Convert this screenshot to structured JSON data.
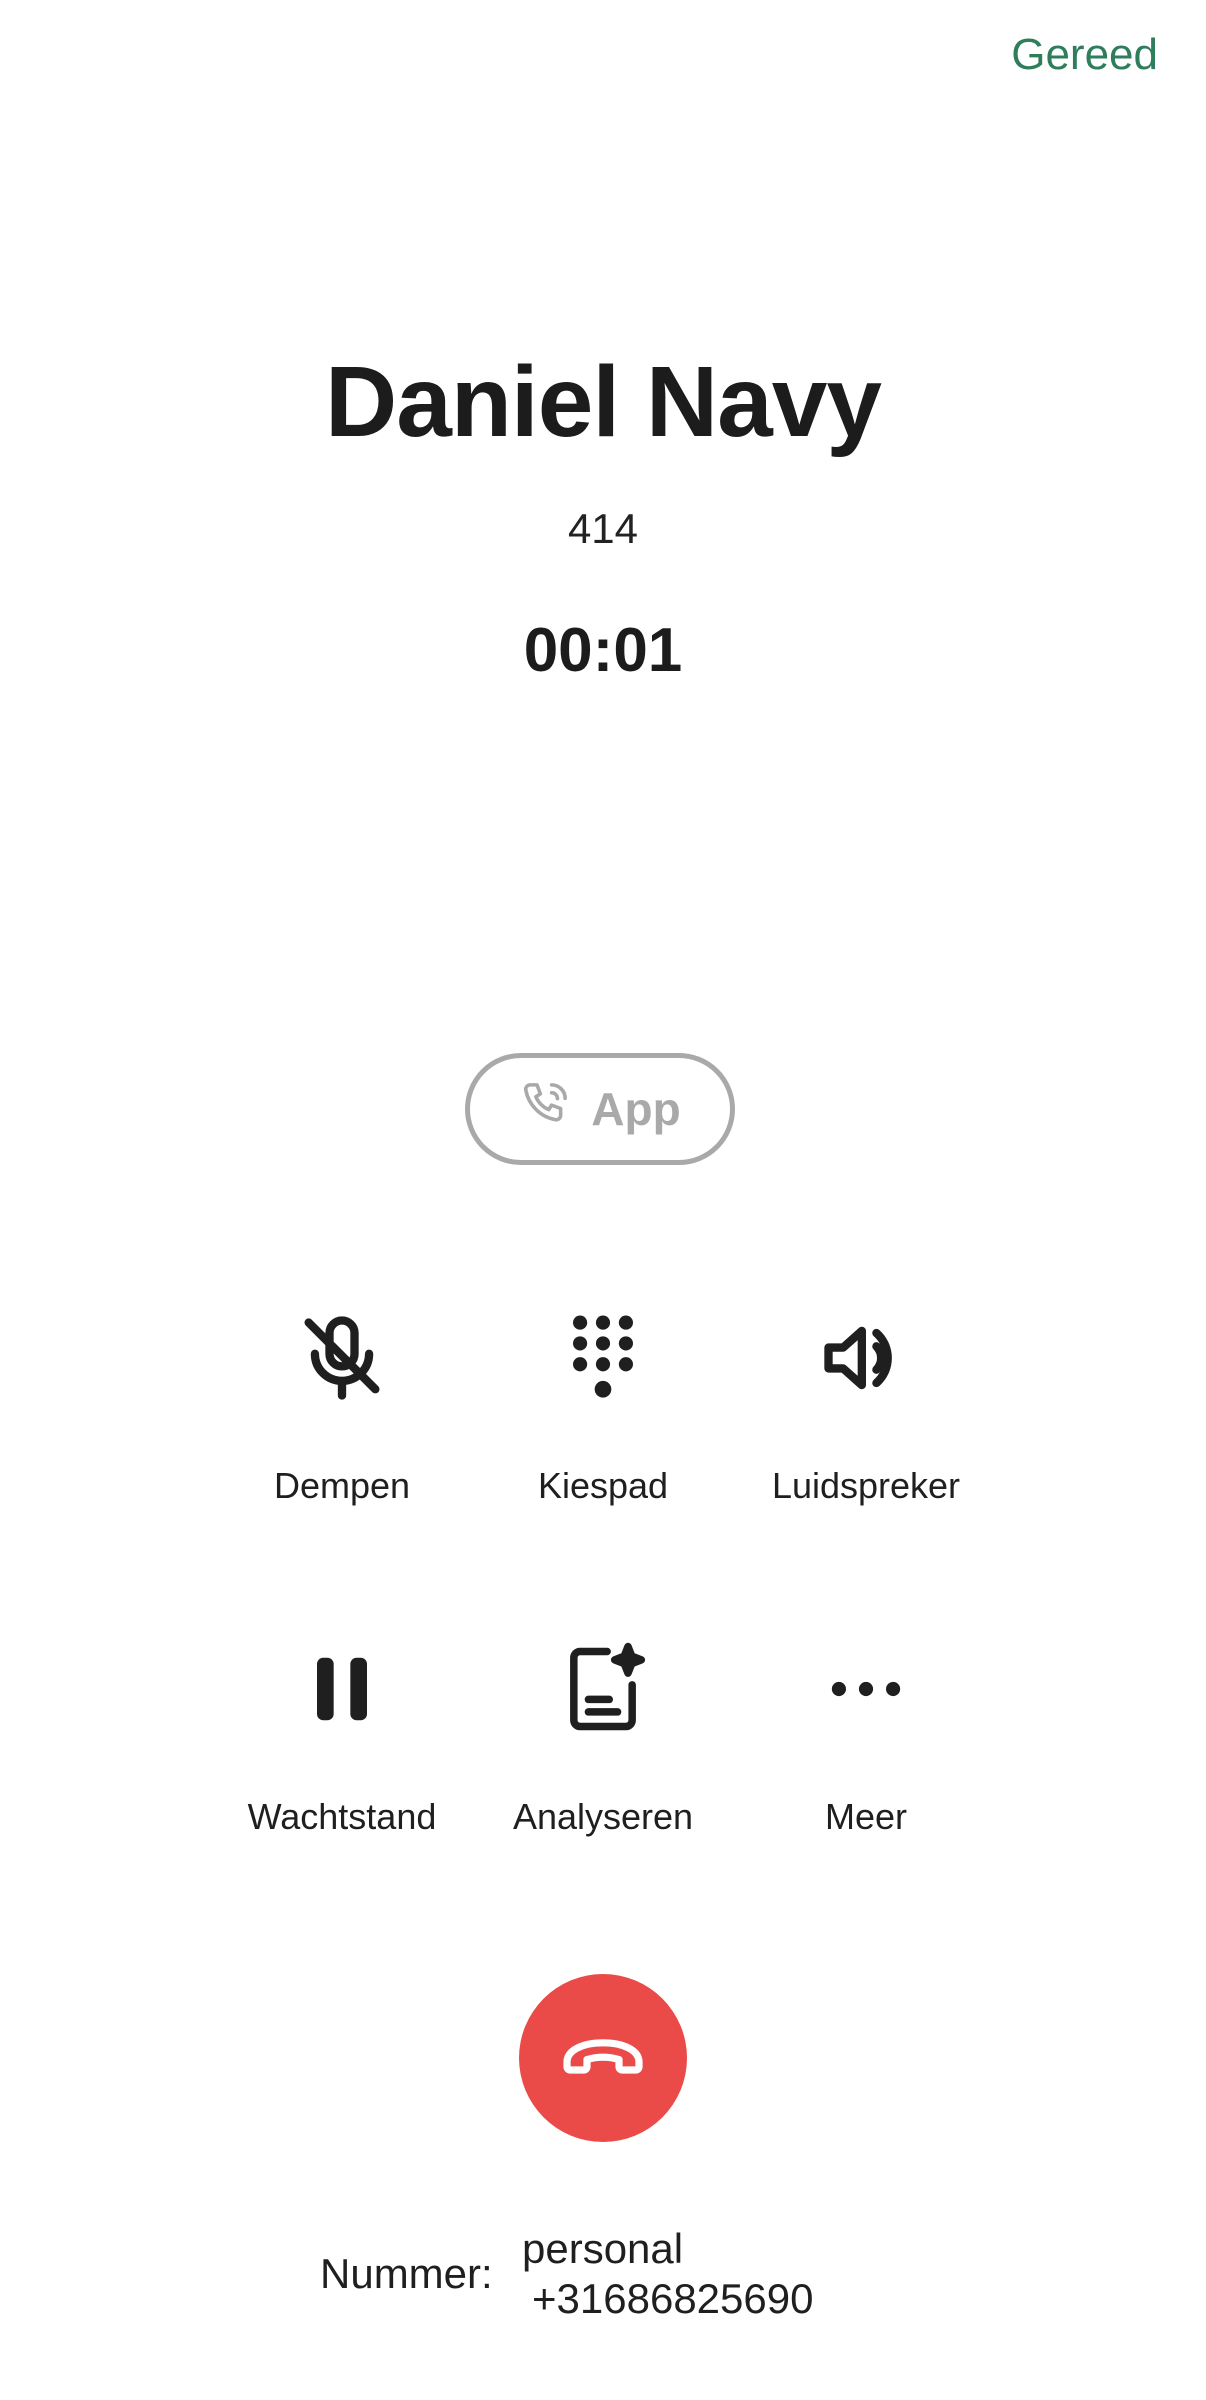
{
  "header": {
    "done_label": "Gereed"
  },
  "caller": {
    "name": "Daniel Navy",
    "extension": "414",
    "timer": "00:01"
  },
  "app_switch": {
    "label": "App",
    "icon": "phone-call-icon"
  },
  "controls": [
    {
      "label": "Dempen",
      "icon": "mic-off-icon"
    },
    {
      "label": "Kiespad",
      "icon": "keypad-icon"
    },
    {
      "label": "Luidspreker",
      "icon": "speaker-icon"
    },
    {
      "label": "Wachtstand",
      "icon": "pause-icon"
    },
    {
      "label": "Analyseren",
      "icon": "analyze-document-icon"
    },
    {
      "label": "Meer",
      "icon": "more-icon"
    }
  ],
  "end_call": {
    "icon": "hang-up-icon",
    "color": "#ea4b48"
  },
  "number": {
    "label": "Nummer:",
    "type": "personal",
    "value": "+31686825690"
  },
  "colors": {
    "accent": "#2e7d5b",
    "end_call": "#ea4b48",
    "disabled": "#a9a9a9"
  }
}
